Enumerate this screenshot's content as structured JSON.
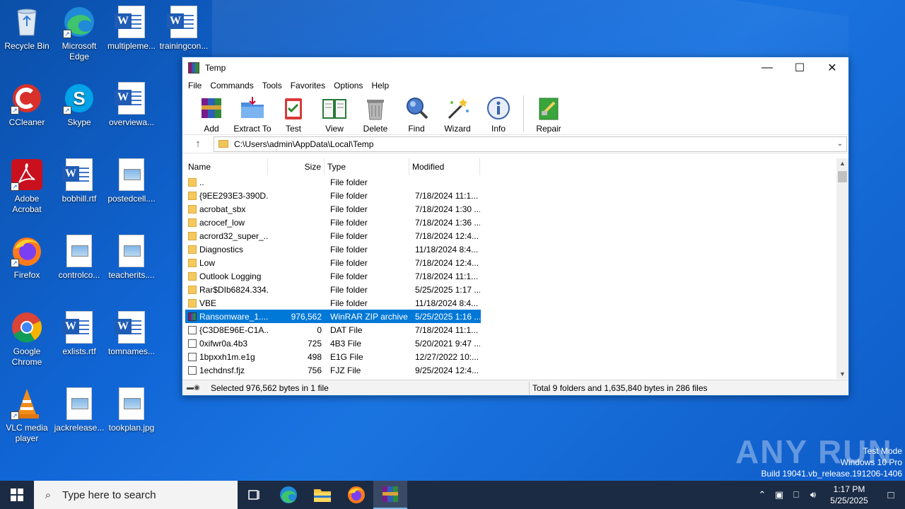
{
  "desktop": {
    "icons": [
      {
        "label": "Recycle Bin"
      },
      {
        "label": "Microsoft Edge"
      },
      {
        "label": "multipleme..."
      },
      {
        "label": "trainingcon..."
      },
      {
        "label": "CCleaner"
      },
      {
        "label": "Skype"
      },
      {
        "label": "overviewa..."
      },
      {
        "label": "Adobe Acrobat"
      },
      {
        "label": "bobhill.rtf"
      },
      {
        "label": "postedcell...."
      },
      {
        "label": "Firefox"
      },
      {
        "label": "controlco..."
      },
      {
        "label": "teacherits...."
      },
      {
        "label": "Google Chrome"
      },
      {
        "label": "exlists.rtf"
      },
      {
        "label": "tomnames..."
      },
      {
        "label": "VLC media player"
      },
      {
        "label": "jackrelease..."
      },
      {
        "label": "tookplan.jpg"
      }
    ]
  },
  "window": {
    "title": "Temp",
    "minimize": "—",
    "maximize": "☐",
    "close": "✕"
  },
  "menu": [
    "File",
    "Commands",
    "Tools",
    "Favorites",
    "Options",
    "Help"
  ],
  "toolbar": {
    "add": "Add",
    "extract": "Extract To",
    "test": "Test",
    "view": "View",
    "delete": "Delete",
    "find": "Find",
    "wizard": "Wizard",
    "info": "Info",
    "repair": "Repair"
  },
  "address": {
    "path": "C:\\Users\\admin\\AppData\\Local\\Temp",
    "up": "↑",
    "chevron": "⌵"
  },
  "columns": {
    "name": "Name",
    "size": "Size",
    "type": "Type",
    "modified": "Modified"
  },
  "rows": [
    {
      "name": "..",
      "size": "",
      "type": "File folder",
      "modified": "",
      "kind": "folder",
      "selected": false
    },
    {
      "name": "{9EE293E3-390D...",
      "size": "",
      "type": "File folder",
      "modified": "7/18/2024 11:1...",
      "kind": "folder",
      "selected": false
    },
    {
      "name": "acrobat_sbx",
      "size": "",
      "type": "File folder",
      "modified": "7/18/2024 1:30 ...",
      "kind": "folder",
      "selected": false
    },
    {
      "name": "acrocef_low",
      "size": "",
      "type": "File folder",
      "modified": "7/18/2024 1:36 ...",
      "kind": "folder",
      "selected": false
    },
    {
      "name": "acrord32_super_...",
      "size": "",
      "type": "File folder",
      "modified": "7/18/2024 12:4...",
      "kind": "folder",
      "selected": false
    },
    {
      "name": "Diagnostics",
      "size": "",
      "type": "File folder",
      "modified": "11/18/2024 8:4...",
      "kind": "folder",
      "selected": false
    },
    {
      "name": "Low",
      "size": "",
      "type": "File folder",
      "modified": "7/18/2024 12:4...",
      "kind": "folder",
      "selected": false
    },
    {
      "name": "Outlook Logging",
      "size": "",
      "type": "File folder",
      "modified": "7/18/2024 11:1...",
      "kind": "folder",
      "selected": false
    },
    {
      "name": "Rar$DIb6824.334...",
      "size": "",
      "type": "File folder",
      "modified": "5/25/2025 1:17 ...",
      "kind": "folder",
      "selected": false
    },
    {
      "name": "VBE",
      "size": "",
      "type": "File folder",
      "modified": "11/18/2024 8:4...",
      "kind": "folder",
      "selected": false
    },
    {
      "name": "Ransomware_1....",
      "size": "976,562",
      "type": "WinRAR ZIP archive",
      "modified": "5/25/2025 1:16 ...",
      "kind": "zip",
      "selected": true
    },
    {
      "name": "{C3D8E96E-C1A...",
      "size": "0",
      "type": "DAT File",
      "modified": "7/18/2024 11:1...",
      "kind": "file",
      "selected": false
    },
    {
      "name": "0xifwr0a.4b3",
      "size": "725",
      "type": "4B3 File",
      "modified": "5/20/2021 9:47 ...",
      "kind": "file",
      "selected": false
    },
    {
      "name": "1bpxxh1m.e1g",
      "size": "498",
      "type": "E1G File",
      "modified": "12/27/2022 10:...",
      "kind": "file",
      "selected": false
    },
    {
      "name": "1echdnsf.fjz",
      "size": "756",
      "type": "FJZ File",
      "modified": "9/25/2024 12:4...",
      "kind": "file",
      "selected": false
    }
  ],
  "status": {
    "left": "Selected 976,562 bytes in 1 file",
    "right": "Total 9 folders and 1,635,840 bytes in 286 files"
  },
  "watermark": {
    "brand": "ANY RUN",
    "line1": "Test Mode",
    "line2": "Windows 10 Pro",
    "line3": "Build 19041.vb_release.191206-1406"
  },
  "taskbar": {
    "search_placeholder": "Type here to search",
    "time": "1:17 PM",
    "date": "5/25/2025"
  }
}
